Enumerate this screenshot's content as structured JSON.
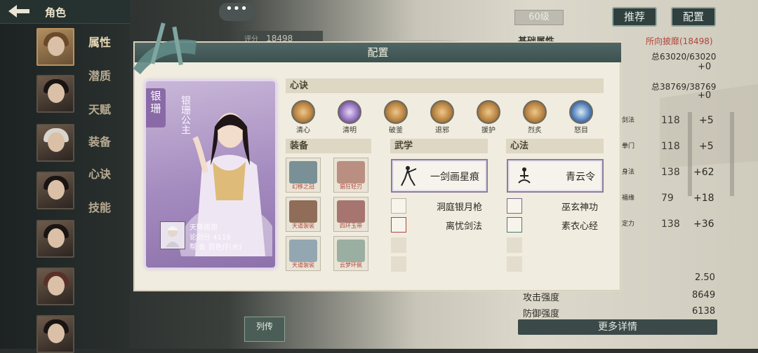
{
  "nav": {
    "back_icon": "back-arrow-icon",
    "title": "角色",
    "chat_icon": "more-dots-icon"
  },
  "menu": [
    "属性",
    "潜质",
    "天赋",
    "装备",
    "心诀",
    "技能"
  ],
  "background": {
    "score_label": "评分",
    "score": "18498",
    "level": "60级",
    "btn_recommend": "推荐",
    "btn_config": "配置",
    "base_attr": "基础属性",
    "invincible": "所向披靡(18498)",
    "hp": "总63020/63020",
    "hp_plus": "+0",
    "mp": "总38769/38769",
    "mp_plus": "+0",
    "attrs": [
      {
        "name": "剑法",
        "val": "118",
        "plus": "+5"
      },
      {
        "name": "拳门",
        "val": "118",
        "plus": "+5"
      },
      {
        "name": "身法",
        "val": "138",
        "plus": "+62"
      },
      {
        "name": "福缘",
        "val": "79",
        "plus": "+18"
      },
      {
        "name": "定力",
        "val": "138",
        "plus": "+36"
      }
    ],
    "crit_val": "2.50",
    "atk_label": "攻击强度",
    "atk": "8649",
    "def_label": "防御强度",
    "def": "6138",
    "more": "更多详情",
    "lie_zhuan": "列传"
  },
  "modal": {
    "title": "配置",
    "character": {
      "tag": "银珊",
      "title": "银珊公主",
      "player": "天降周周",
      "score_label": "论剑分",
      "score": "4119",
      "guild_label": "帮 会",
      "guild": "百色仔(水)"
    },
    "xinjue_header": "心诀",
    "xinjue": [
      {
        "label": "清心",
        "icon": "lotus-icon"
      },
      {
        "label": "清明",
        "icon": "spirit-icon"
      },
      {
        "label": "破釜",
        "icon": "shield-icon"
      },
      {
        "label": "退邪",
        "icon": "gate-icon"
      },
      {
        "label": "援护",
        "icon": "guard-icon"
      },
      {
        "label": "烈炙",
        "icon": "flame-icon"
      },
      {
        "label": "怒目",
        "icon": "eye-icon"
      }
    ],
    "equip_header": "装备",
    "equipment": [
      {
        "label": "幻移之冠",
        "color": "#2e5a6a"
      },
      {
        "label": "猖狂轻刃",
        "color": "#8c3a2c"
      },
      {
        "label": "天道袈裟",
        "color": "#6a3a22"
      },
      {
        "label": "四环玉带",
        "color": "#7a2c2c"
      },
      {
        "label": "天道袈裟",
        "color": "#3b6a8c"
      },
      {
        "label": "云梦环佩",
        "color": "#4c7a6c"
      }
    ],
    "wuxue_header": "武学",
    "wuxue_main": "一剑画星痕",
    "wuxue_list": [
      "洞庭银月枪",
      "离忧剑法"
    ],
    "xinfa_header": "心法",
    "xinfa_main": "青云令",
    "xinfa_list": [
      "巫玄神功",
      "素衣心经"
    ]
  }
}
